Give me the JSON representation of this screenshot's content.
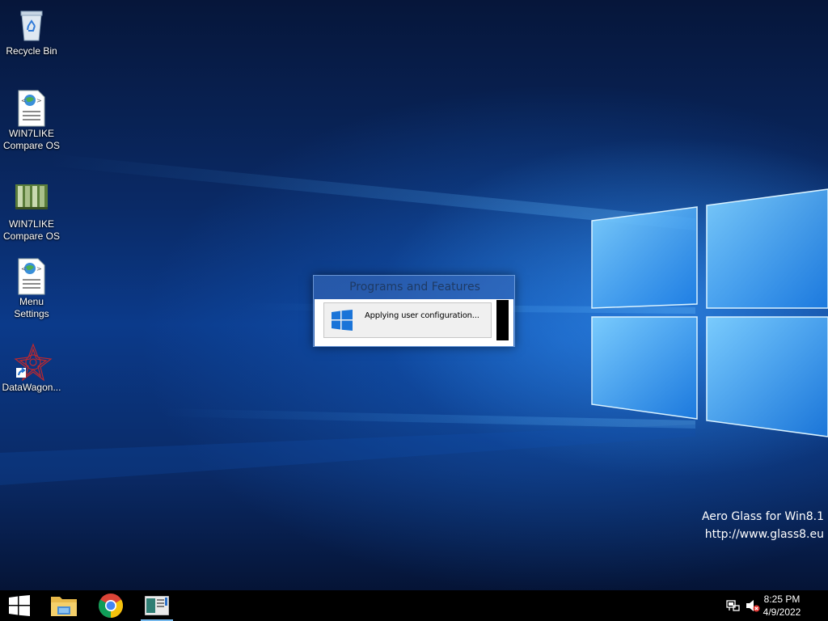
{
  "desktop": {
    "icons": [
      {
        "label": "Recycle Bin",
        "icon": "recycle-bin-icon"
      },
      {
        "label": "WIN7LIKE\nCompare OS",
        "icon": "html-document-icon"
      },
      {
        "label": "WIN7LIKE\nCompare OS",
        "icon": "image-file-icon"
      },
      {
        "label": "Menu\nSettings",
        "icon": "html-document-icon"
      },
      {
        "label": "DataWagon...",
        "icon": "shortcut-icon"
      }
    ],
    "watermark": {
      "line1": "Aero Glass for Win8.1",
      "line2": "http://www.glass8.eu"
    }
  },
  "dialog": {
    "title": "Programs and Features",
    "message": "Applying user configuration..."
  },
  "taskbar": {
    "apps": [
      {
        "name": "start-button",
        "icon": "windows-logo-icon"
      },
      {
        "name": "file-explorer",
        "icon": "folder-icon"
      },
      {
        "name": "chrome",
        "icon": "chrome-icon"
      },
      {
        "name": "open-app",
        "icon": "window-app-icon"
      }
    ],
    "tray": {
      "network": "network-icon",
      "volume": "volume-muted-icon"
    },
    "clock": {
      "time": "8:25 PM",
      "date": "4/9/2022"
    }
  },
  "colors": {
    "accent_blue": "#1a74d8",
    "taskbar": "#000000"
  }
}
